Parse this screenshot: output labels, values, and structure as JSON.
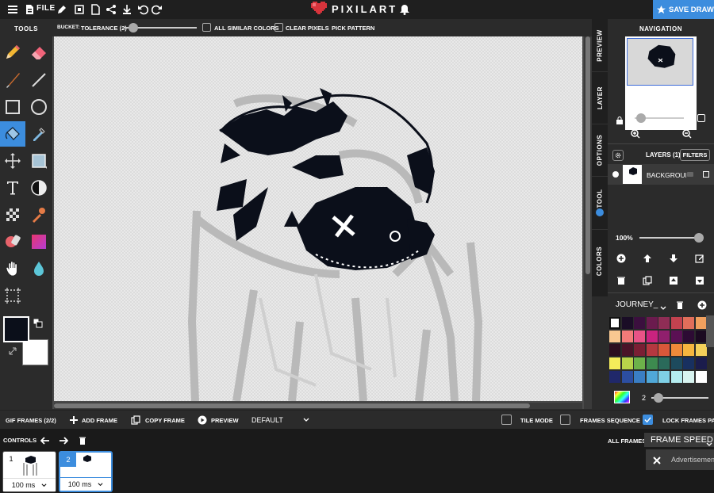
{
  "topbar": {
    "file_label": "FILE",
    "logo_text": "PIXILART",
    "save_label": "SAVE DRAWING"
  },
  "tools": {
    "title": "TOOLS",
    "items": [
      "pencil",
      "eraser",
      "brush",
      "line",
      "rectangle",
      "ellipse",
      "bucket",
      "eyedropper",
      "move",
      "shape-fill",
      "text",
      "dither",
      "pattern",
      "stamp",
      "bubble-eraser",
      "gradient",
      "hand",
      "drop",
      "selection"
    ],
    "active": "bucket",
    "primary_color": "#0b0f1a",
    "secondary_color": "#ffffff"
  },
  "options": {
    "bucket_label": "BUCKET:",
    "tolerance_label": "TOLERANCE (2)",
    "all_similar_label": "ALL SIMILAR COLORS",
    "clear_pixels_label": "CLEAR PIXELS",
    "pick_pattern_label": "PICK PATTERN"
  },
  "side_tabs": [
    "PREVIEW",
    "LAYER",
    "OPTIONS",
    "TOOL",
    "COLORS"
  ],
  "right_panel": {
    "navigation_title": "NAVIGATION",
    "layers_label": "LAYERS (1)",
    "filters_label": "FILTERS",
    "layer_name": "BACKGROUND",
    "opacity": "100%",
    "palette_name": "JOURNEY_",
    "brush_size": "2",
    "swatches": [
      "#ffffff",
      "#1a0d26",
      "#3b0f3e",
      "#6b1b4e",
      "#8f2d55",
      "#c2424f",
      "#e06e5a",
      "#f0a05e",
      "#f9c891",
      "#f27b79",
      "#e85386",
      "#c9237f",
      "#901f6d",
      "#5b1054",
      "#2d0b34",
      "#1b0a21",
      "#2c0f1f",
      "#4a1428",
      "#7a1f34",
      "#b53840",
      "#d9573a",
      "#ee8a3a",
      "#f6b63f",
      "#f4d05a",
      "#f5ec5a",
      "#b8d34a",
      "#6db24a",
      "#3d8b4f",
      "#2a6a5a",
      "#1d4a5d",
      "#183060",
      "#1b1c4c",
      "#20286a",
      "#2c4ea0",
      "#3a7ec4",
      "#50a8d8",
      "#7fd0e6",
      "#b4ecef",
      "#d8f4f0",
      "#ffffff"
    ]
  },
  "frames_bar": {
    "gif_frames": "GIF FRAMES (2/2)",
    "add_frame": "ADD FRAME",
    "copy_frame": "COPY FRAME",
    "preview": "PREVIEW",
    "mode": "DEFAULT",
    "tile_mode": "TILE MODE",
    "frames_sequence": "FRAMES SEQUENCE",
    "lock_frames": "LOCK FRAMES PANEL"
  },
  "controls": {
    "title": "CONTROLS",
    "all_frames": "ALL FRAMES",
    "frame_speed": "FRAME SPEED",
    "advertisement": "Advertisement",
    "frames": [
      {
        "number": "1",
        "duration": "100 ms"
      },
      {
        "number": "2",
        "duration": "100 ms"
      }
    ]
  }
}
